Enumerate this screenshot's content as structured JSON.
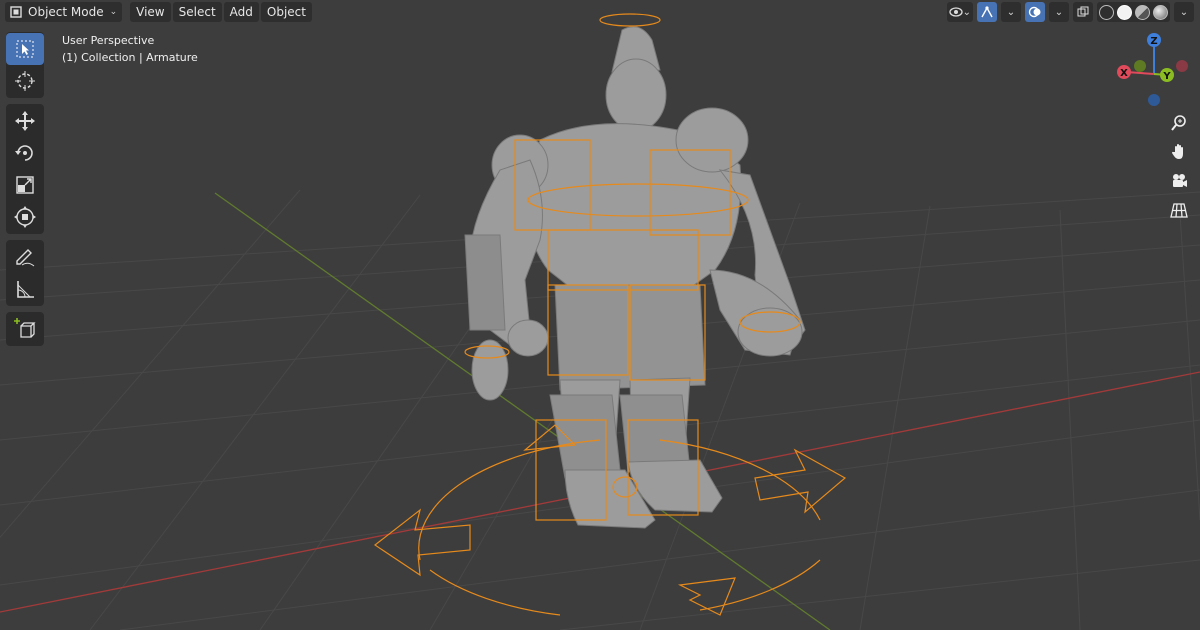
{
  "header": {
    "mode_label": "Object Mode",
    "menu": [
      "View",
      "Select",
      "Add",
      "Object"
    ]
  },
  "viewport_info": {
    "line1": "User Perspective",
    "line2": "(1) Collection | Armature"
  },
  "toolbar": {
    "tools": [
      "select-box",
      "cursor",
      "move",
      "rotate",
      "scale",
      "transform",
      "annotate",
      "measure",
      "add-cube"
    ],
    "active": "select-box"
  },
  "gizmo": {
    "axes": {
      "x": "X",
      "y": "Y",
      "z": "Z"
    },
    "colors": {
      "x": "#e04a5b",
      "y": "#8bbd22",
      "z": "#3f7fdc",
      "x_neg": "#8a3a44",
      "y_neg": "#5e7a23",
      "z_neg": "#2f5a98"
    }
  },
  "nav_buttons": [
    "zoom",
    "pan",
    "camera",
    "orthographic"
  ],
  "colors": {
    "background": "#3d3d3d",
    "active_tool": "#4772b3",
    "armature": "#e68a1c",
    "x_axis": "#a23a3a",
    "y_axis": "#607a2e",
    "model": "#9a9a9a"
  }
}
